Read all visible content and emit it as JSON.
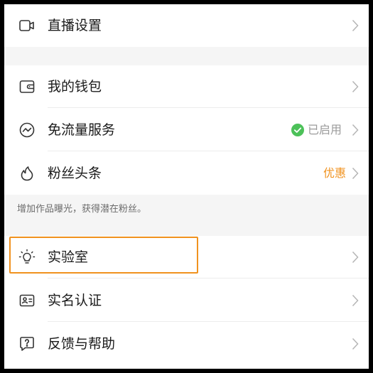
{
  "menu": {
    "live_settings": {
      "label": "直播设置"
    },
    "wallet": {
      "label": "我的钱包"
    },
    "free_data": {
      "label": "免流量服务",
      "status": "已启用"
    },
    "fan_headline": {
      "label": "粉丝头条",
      "status": "优惠"
    },
    "fan_headline_hint": "增加作品曝光，获得潜在粉丝。",
    "lab": {
      "label": "实验室"
    },
    "real_name": {
      "label": "实名认证"
    },
    "feedback": {
      "label": "反馈与帮助"
    }
  },
  "colors": {
    "accent_orange": "#f0921e",
    "status_green": "#4cc159",
    "status_gray": "#9b9b9b",
    "chevron": "#b5b5b5"
  }
}
